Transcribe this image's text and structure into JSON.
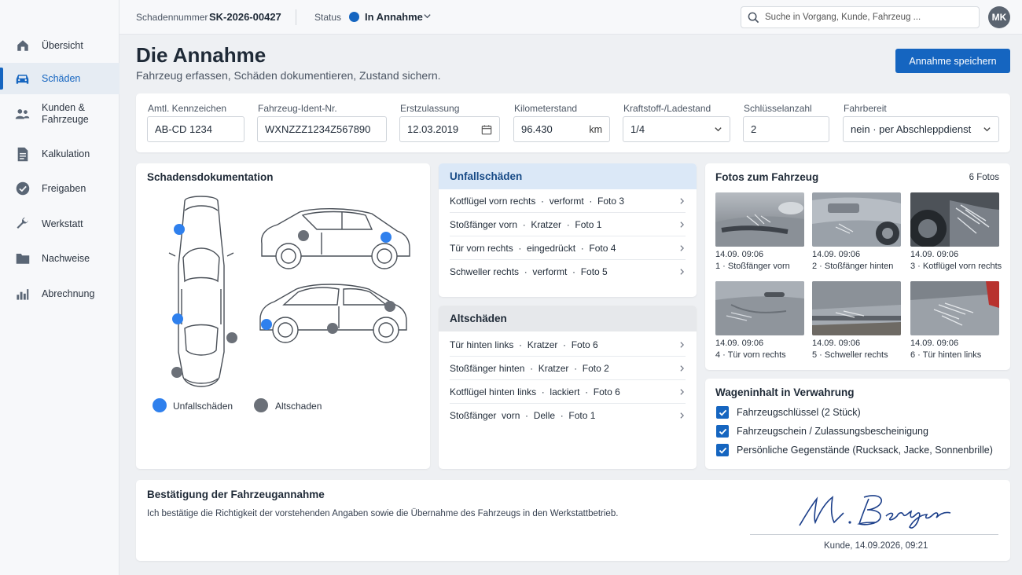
{
  "colors": {
    "accent": "#1565c0",
    "accident_marker": "#2f80ed",
    "old_damage_marker": "#6b7078"
  },
  "nav": {
    "items": [
      {
        "label": "Übersicht",
        "icon": "home-icon"
      },
      {
        "label": "Schäden",
        "icon": "car-icon",
        "active": true
      },
      {
        "label": "Kunden &\nFahrzeuge",
        "icon": "users-icon"
      },
      {
        "label": "Kalkulation",
        "icon": "document-icon"
      },
      {
        "label": "Freigaben",
        "icon": "check-circle-icon"
      },
      {
        "label": "Werkstatt",
        "icon": "wrench-icon"
      },
      {
        "label": "Nachweise",
        "icon": "folder-icon"
      },
      {
        "label": "Abrechnung",
        "icon": "bar-chart-icon"
      }
    ]
  },
  "topbar": {
    "claim_label": "Schadennummer",
    "claim_number": "SK-2026-00427",
    "status_label": "Status",
    "status_value": "In Annahme",
    "search_placeholder": "Suche in Vorgang, Kunde, Fahrzeug ...",
    "avatar_initials": "MK"
  },
  "header": {
    "title": "Die Annahme",
    "subtitle": "Fahrzeug erfassen, Schäden dokumentieren, Zustand sichern.",
    "save_label": "Annahme speichern"
  },
  "vehicle_fields": {
    "plate": {
      "label": "Amtl. Kennzeichen",
      "value": "AB-CD 1234"
    },
    "vin": {
      "label": "Fahrzeug-Ident-Nr.",
      "value": "WXNZZZ1234Z567890"
    },
    "registration": {
      "label": "Erstzulassung",
      "value": "12.03.2019"
    },
    "mileage": {
      "label": "Kilometerstand",
      "value": "96.430",
      "unit": "km"
    },
    "fuel": {
      "label": "Kraftstoff-/Ladestand",
      "value": "1/4"
    },
    "keys": {
      "label": "Schlüsselanzahl",
      "value": "2"
    },
    "drivable": {
      "label": "Fahrbereit",
      "value": "nein · per Abschleppdienst"
    }
  },
  "documentation": {
    "title": "Schadensdokumentation",
    "legend_accident": "Unfallschäden",
    "legend_old": "Altschaden"
  },
  "accident_damages": {
    "title": "Unfallschäden",
    "items": [
      "Kotflügel vorn rechts  ·  verformt  ·  Foto 3",
      "Stoßfänger vorn  ·  Kratzer  ·  Foto 1",
      "Tür vorn rechts  ·  eingedrückt  ·  Foto 4",
      "Schweller rechts  ·  verformt  ·  Foto 5"
    ]
  },
  "old_damages": {
    "title": "Altschäden",
    "items": [
      "Tür hinten links  ·  Kratzer  ·  Foto 6",
      "Stoßfänger hinten  ·  Kratzer  ·  Foto 2",
      "Kotflügel hinten links  ·  lackiert  ·  Foto 6",
      "Stoßfänger  vorn  ·  Delle  ·  Foto 1"
    ]
  },
  "photos": {
    "title": "Fotos zum Fahrzeug",
    "count": "6 Fotos",
    "items": [
      {
        "time": "14.09. 09:06",
        "caption": "1 · Stoßfänger vorn"
      },
      {
        "time": "14.09. 09:06",
        "caption": "2 · Stoßfänger hinten"
      },
      {
        "time": "14.09. 09:06",
        "caption": "3 · Kotflügel vorn rechts"
      },
      {
        "time": "14.09. 09:06",
        "caption": "4 · Tür vorn rechts"
      },
      {
        "time": "14.09. 09:06",
        "caption": "5 · Schweller rechts"
      },
      {
        "time": "14.09. 09:06",
        "caption": "6 · Tür hinten links"
      }
    ]
  },
  "custody": {
    "title": "Wageninhalt in Verwahrung",
    "items": [
      "Fahrzeugschlüssel (2 Stück)",
      "Fahrzeugschein / Zulassungsbescheinigung",
      "Persönliche Gegenstände (Rucksack, Jacke, Sonnenbrille)"
    ]
  },
  "confirmation": {
    "title": "Bestätigung der Fahrzeugannahme",
    "text": "Ich bestätige die Richtigkeit der vorstehenden Angaben sowie die Übernahme des Fahrzeugs in den Werkstattbetrieb.",
    "signature_caption": "Kunde, 14.09.2026, 09:21"
  }
}
